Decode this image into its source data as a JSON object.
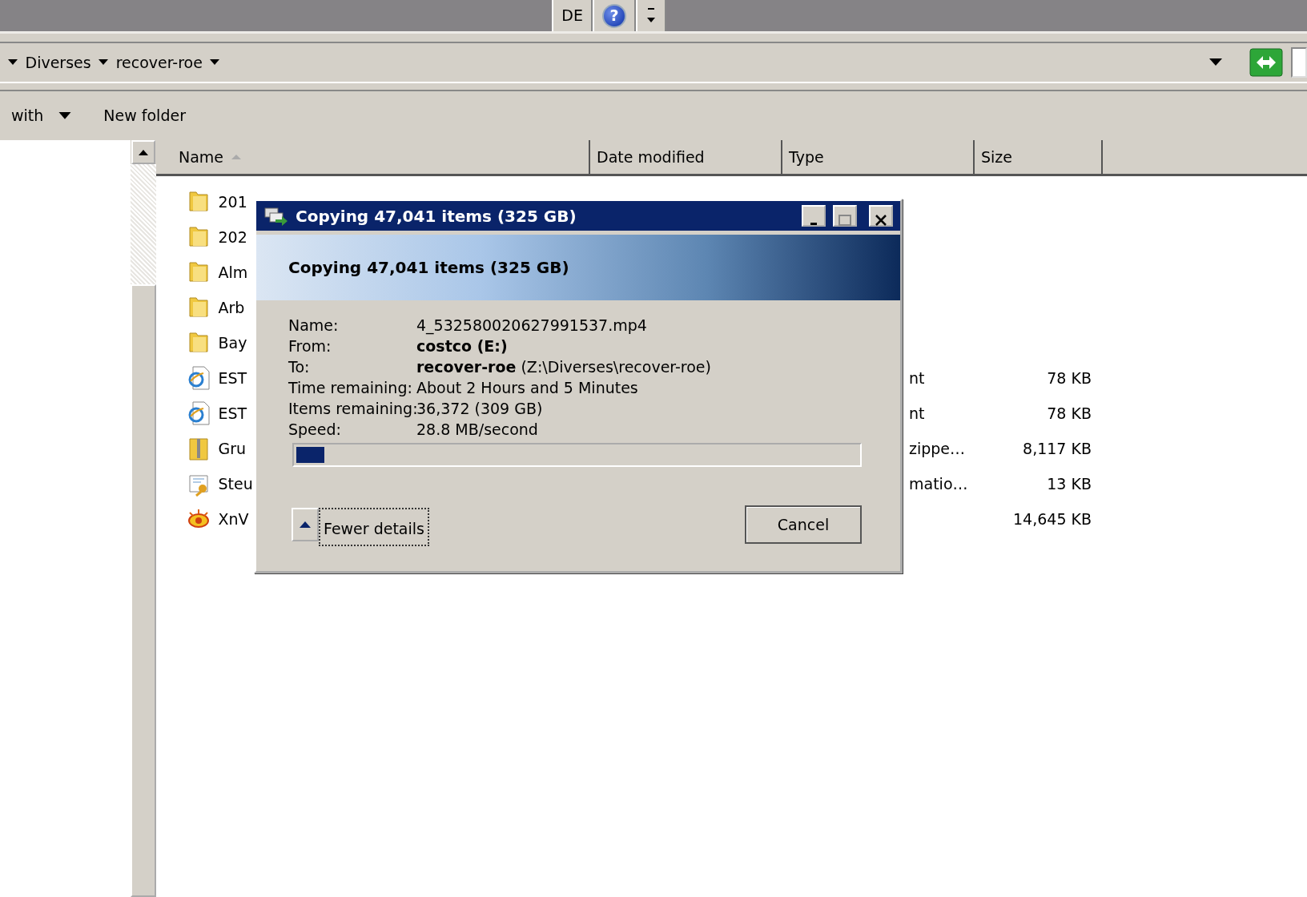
{
  "taskbar": {
    "language": "DE",
    "help_glyph": "?"
  },
  "address_bar": {
    "breadcrumbs": [
      "Diverses",
      "recover-roe"
    ]
  },
  "toolbar": {
    "items": [
      {
        "label": "with",
        "has_menu": true
      },
      {
        "label": "New folder",
        "has_menu": false
      }
    ]
  },
  "columns": [
    {
      "label": "Name",
      "sorted": true
    },
    {
      "label": "Date modified",
      "sorted": false
    },
    {
      "label": "Type",
      "sorted": false
    },
    {
      "label": "Size",
      "sorted": false
    }
  ],
  "files": [
    {
      "kind": "folder",
      "name": "201"
    },
    {
      "kind": "folder",
      "name": "202"
    },
    {
      "kind": "folder",
      "name": "Alm"
    },
    {
      "kind": "folder",
      "name": "Arb"
    },
    {
      "kind": "folder",
      "name": "Bay"
    },
    {
      "kind": "web",
      "name": "EST",
      "type": "nt",
      "size": "78 KB"
    },
    {
      "kind": "web",
      "name": "EST",
      "type": "nt",
      "size": "78 KB"
    },
    {
      "kind": "zip",
      "name": "Gru",
      "type": "zippe…",
      "size": "8,117 KB"
    },
    {
      "kind": "cert",
      "name": "Steu",
      "type": "matio…",
      "size": "13 KB"
    },
    {
      "kind": "app",
      "name": "XnV",
      "size": "14,645 KB"
    }
  ],
  "dialog": {
    "title": "Copying 47,041 items (325 GB)",
    "heading": "Copying 47,041 items (325 GB)",
    "details": [
      {
        "label": "Name:",
        "value": "4_532580020627991537.mp4",
        "bold": false
      },
      {
        "label": "From:",
        "value": "costco (E:)",
        "bold": true
      },
      {
        "label": "To:",
        "value": "**recover-roe** (Z:\\Diverses\\recover-roe)",
        "bold": false
      },
      {
        "label": "Time remaining:",
        "value": "About 2 Hours and 5 Minutes",
        "bold": false
      },
      {
        "label": "Items remaining:",
        "value": "36,372 (309 GB)",
        "bold": false
      },
      {
        "label": "Speed:",
        "value": "28.8 MB/second",
        "bold": false
      }
    ],
    "progress": {
      "level": 0.05
    },
    "details_toggle": {
      "label": "Fewer details",
      "expanded": true
    },
    "cancel": "Cancel"
  }
}
